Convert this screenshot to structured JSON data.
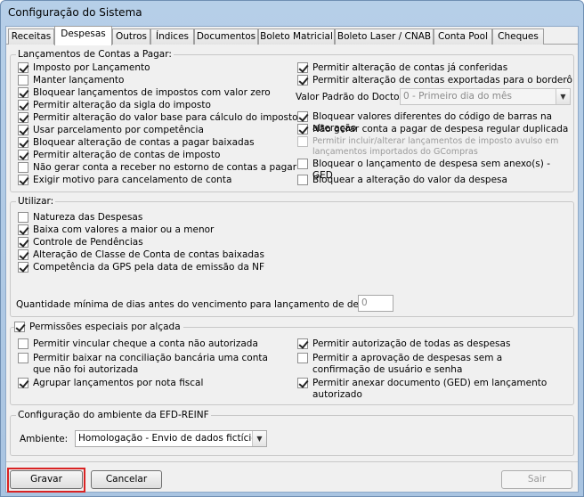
{
  "window": {
    "title": "Configuração do Sistema"
  },
  "tabs": [
    "Receitas",
    "Despesas",
    "Outros",
    "Índices",
    "Documentos",
    "Boleto Matricial",
    "Boleto Laser / CNAB",
    "Conta Pool",
    "Cheques"
  ],
  "active_tab": "Despesas",
  "lancamentos": {
    "title": "Lançamentos de Contas a Pagar:",
    "left": [
      {
        "label": "Imposto por Lançamento",
        "checked": true
      },
      {
        "label": "Manter lançamento",
        "checked": false
      },
      {
        "label": "Bloquear lançamentos de impostos com valor zero",
        "checked": true
      },
      {
        "label": "Permitir alteração da sigla do imposto",
        "checked": true
      },
      {
        "label": "Permitir alteração do valor base para cálculo do imposto",
        "checked": true
      },
      {
        "label": "Usar parcelamento por competência",
        "checked": true
      },
      {
        "label": "Bloquear alteração de contas a pagar baixadas",
        "checked": true
      },
      {
        "label": "Permitir alteração de contas de imposto",
        "checked": true
      },
      {
        "label": "Não gerar conta a receber no estorno de contas a pagar",
        "checked": false
      },
      {
        "label": "Exigir motivo para cancelamento de conta",
        "checked": true
      }
    ],
    "right_top": [
      {
        "label": "Permitir alteração de contas já conferidas",
        "checked": true
      },
      {
        "label": "Permitir alteração de contas exportadas para o borderô",
        "checked": true
      }
    ],
    "valor_padrao_label": "Valor Padrão do Docto.",
    "valor_padrao_value": "0 - Primeiro dia do mês",
    "right_bottom": [
      {
        "label": "Bloquear valores diferentes do código de barras na alteração",
        "checked": true
      },
      {
        "label": "Não gerar conta a pagar de despesa regular duplicada",
        "checked": true
      },
      {
        "label": "Permitir incluir/alterar lançamentos de imposto avulso em lançamentos importados do GCompras",
        "checked": false,
        "disabled": true
      },
      {
        "label": "Bloquear o lançamento de despesa sem anexo(s) - GED",
        "checked": false
      },
      {
        "label": "Bloquear a alteração do valor da despesa",
        "checked": false
      }
    ]
  },
  "utilizar": {
    "title": "Utilizar:",
    "items": [
      {
        "label": "Natureza das Despesas",
        "checked": false
      },
      {
        "label": "Baixa com valores a maior ou a menor",
        "checked": true
      },
      {
        "label": "Controle de Pendências",
        "checked": true
      },
      {
        "label": "Alteração de Classe de Conta de contas baixadas",
        "checked": true
      },
      {
        "label": "Competência da GPS pela data de emissão da NF",
        "checked": true
      }
    ],
    "qtd_label": "Quantidade mínima de dias antes do vencimento para lançamento de despesa:",
    "qtd_value": "0"
  },
  "permissoes": {
    "title": "Permissões especiais por alçada",
    "title_checked": true,
    "left": [
      {
        "label": "Permitir vincular cheque a conta não autorizada",
        "checked": false
      },
      {
        "label": "Permitir baixar na conciliação bancária uma conta que não foi autorizada",
        "checked": false
      },
      {
        "label": "Agrupar lançamentos por nota fiscal",
        "checked": true
      }
    ],
    "right": [
      {
        "label": "Permitir autorização de todas as despesas",
        "checked": true
      },
      {
        "label": "Permitir a aprovação de despesas sem a confirmação de usuário e senha",
        "checked": false
      },
      {
        "label": "Permitir anexar documento (GED) em lançamento autorizado",
        "checked": true
      }
    ]
  },
  "efd": {
    "title": "Configuração do ambiente da EFD-REINF",
    "ambiente_label": "Ambiente:",
    "ambiente_value": "Homologação - Envio de dados fictícios"
  },
  "buttons": {
    "gravar": "Gravar",
    "cancelar": "Cancelar",
    "sair": "Sair"
  }
}
